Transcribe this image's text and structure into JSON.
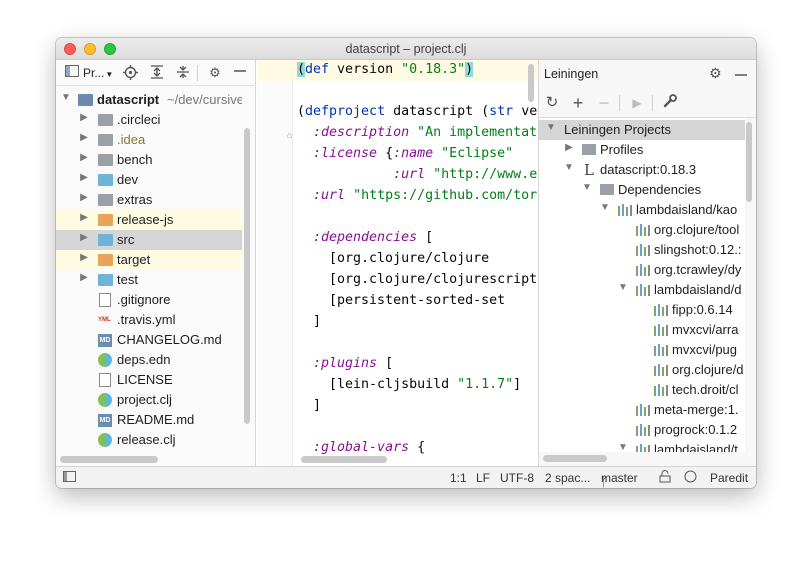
{
  "window": {
    "title": "datascript – project.clj"
  },
  "project_panel": {
    "view_label": "Pr...",
    "tree": [
      {
        "label": "datascript",
        "path": "~/dev/cursive",
        "type": "root"
      },
      {
        "label": ".circleci",
        "type": "folder-grey"
      },
      {
        "label": ".idea",
        "type": "folder-grey"
      },
      {
        "label": "bench",
        "type": "folder-grey"
      },
      {
        "label": "dev",
        "type": "folder-blue"
      },
      {
        "label": "extras",
        "type": "folder-grey"
      },
      {
        "label": "release-js",
        "type": "folder-orange"
      },
      {
        "label": "src",
        "type": "folder-blue"
      },
      {
        "label": "target",
        "type": "folder-orange"
      },
      {
        "label": "test",
        "type": "folder-blue"
      },
      {
        "label": ".gitignore",
        "type": "file"
      },
      {
        "label": ".travis.yml",
        "type": "yml"
      },
      {
        "label": "CHANGELOG.md",
        "type": "md"
      },
      {
        "label": "deps.edn",
        "type": "clj"
      },
      {
        "label": "LICENSE",
        "type": "file"
      },
      {
        "label": "project.clj",
        "type": "clj"
      },
      {
        "label": "README.md",
        "type": "md"
      },
      {
        "label": "release.clj",
        "type": "clj"
      }
    ]
  },
  "editor": {
    "lines": [
      "(def version \"0.18.3\")",
      "",
      "(defproject datascript (str ve",
      "  :description \"An implementat",
      "  :license {:name \"Eclipse\"",
      "            :url \"http://www.e",
      "  :url \"https://github.com/tor",
      "",
      "  :dependencies [",
      "    [org.clojure/clojure",
      "    [org.clojure/clojurescript",
      "    [persistent-sorted-set",
      "  ]",
      "",
      "  :plugins [",
      "    [lein-cljsbuild \"1.1.7\"]",
      "  ]",
      "",
      "  :global-vars {"
    ]
  },
  "leiningen": {
    "title": "Leiningen",
    "tree": [
      {
        "label": "Leiningen Projects"
      },
      {
        "label": "Profiles"
      },
      {
        "label": "datascript:0.18.3"
      },
      {
        "label": "Dependencies"
      },
      {
        "label": "lambdaisland/kao"
      },
      {
        "label": "org.clojure/tool"
      },
      {
        "label": "slingshot:0.12.:"
      },
      {
        "label": "org.tcrawley/dy"
      },
      {
        "label": "lambdaisland/d"
      },
      {
        "label": "fipp:0.6.14"
      },
      {
        "label": "mvxcvi/arra"
      },
      {
        "label": "mvxcvi/pug"
      },
      {
        "label": "org.clojure/d"
      },
      {
        "label": "tech.droit/cl"
      },
      {
        "label": "meta-merge:1."
      },
      {
        "label": "progrock:0.1.2"
      },
      {
        "label": "lambdaisland/t"
      }
    ]
  },
  "status_bar": {
    "position": "1:1",
    "line_sep": "LF",
    "encoding": "UTF-8",
    "indent": "2 spac...",
    "branch": "master",
    "mode": "Paredit"
  },
  "colors": {
    "keyword": "#0033b3",
    "string": "#067d17",
    "keyword_arg": "#871094",
    "selection": "#d5d5d5",
    "highlight": "#fffae3"
  }
}
